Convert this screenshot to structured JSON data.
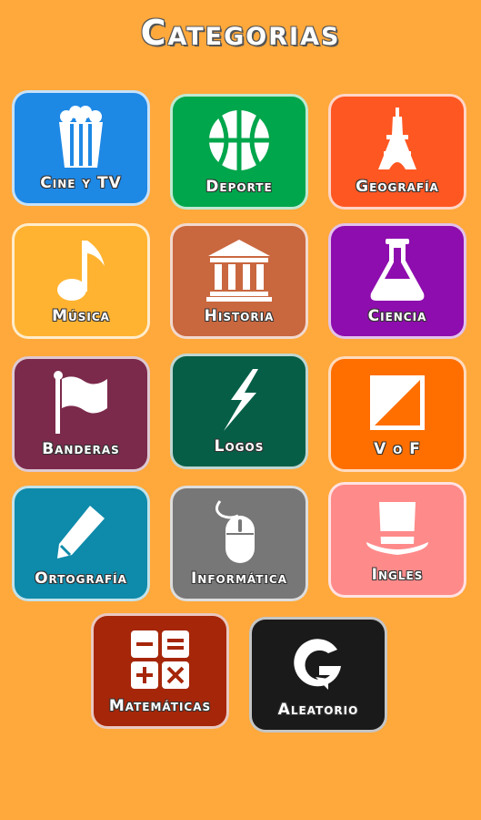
{
  "page": {
    "title": "Categorias"
  },
  "categories": [
    {
      "label": "Cine y TV",
      "color": "#1E88E5",
      "icon": "popcorn-icon"
    },
    {
      "label": "Deporte",
      "color": "#00A64B",
      "icon": "basketball-icon"
    },
    {
      "label": "Geografía",
      "color": "#FF5722",
      "icon": "eiffel-tower-icon"
    },
    {
      "label": "Música",
      "color": "#FFB330",
      "icon": "music-note-icon"
    },
    {
      "label": "Historia",
      "color": "#C9673F",
      "icon": "museum-icon"
    },
    {
      "label": "Ciencia",
      "color": "#8E0DAE",
      "icon": "flask-icon"
    },
    {
      "label": "Banderas",
      "color": "#7B2A4B",
      "icon": "flag-icon"
    },
    {
      "label": "Logos",
      "color": "#065E47",
      "icon": "lightning-icon"
    },
    {
      "label": "V o F",
      "color": "#FF6F00",
      "icon": "true-false-icon"
    },
    {
      "label": "Ortografía",
      "color": "#0E8AAA",
      "icon": "pencil-icon"
    },
    {
      "label": "Informática",
      "color": "#777777",
      "icon": "mouse-icon"
    },
    {
      "label": "Ingles",
      "color": "#FF8A8A",
      "icon": "top-hat-icon"
    },
    {
      "label": "Matemáticas",
      "color": "#A62609",
      "icon": "calculator-icon"
    },
    {
      "label": "Aleatorio",
      "color": "#1A1A1A",
      "icon": "random-g-icon"
    }
  ]
}
